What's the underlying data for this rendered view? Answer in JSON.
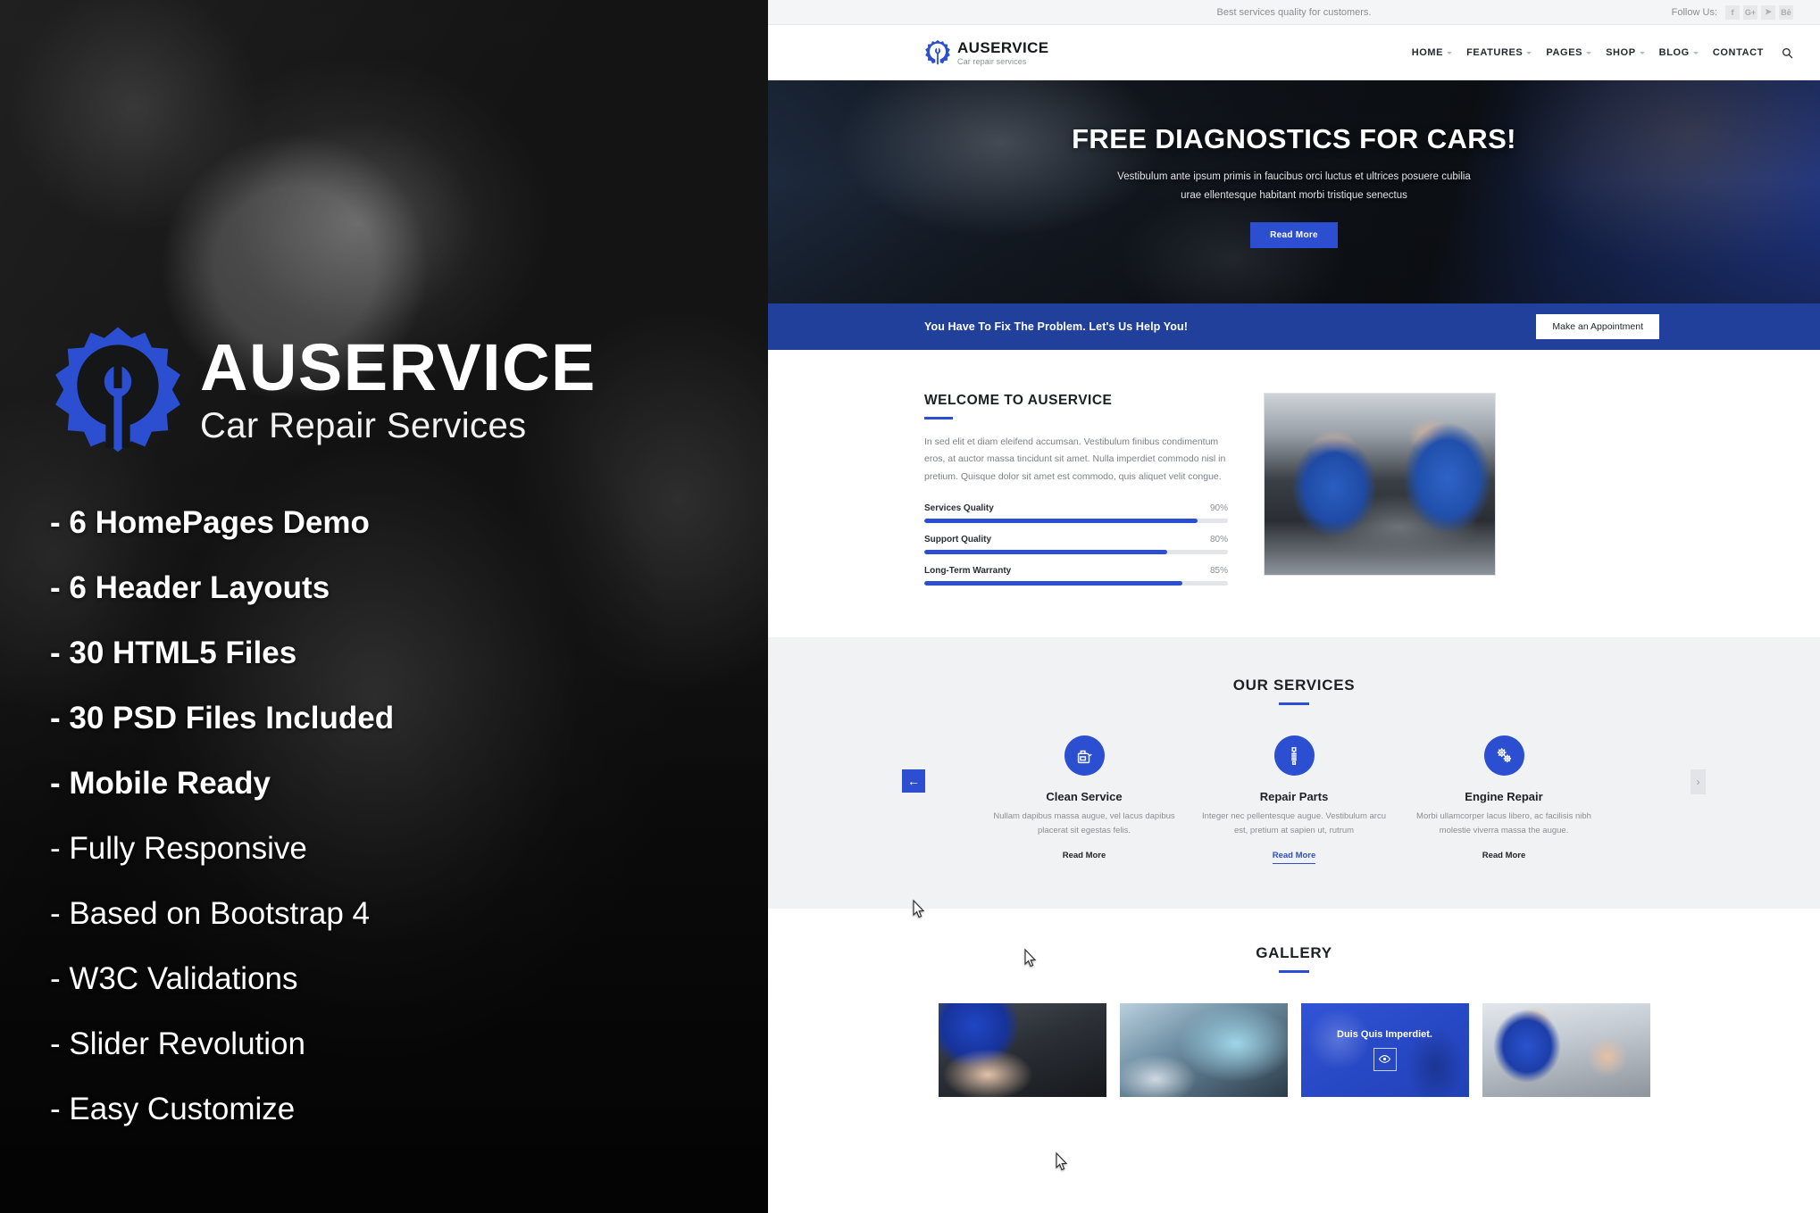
{
  "promo": {
    "brand_name": "AUSERVICE",
    "brand_tagline": "Car Repair Services",
    "logo_icon": "gear-wrench-logo-icon",
    "features": [
      {
        "label": "- 6 HomePages Demo",
        "emphasis": "bold"
      },
      {
        "label": "- 6 Header Layouts",
        "emphasis": "bold"
      },
      {
        "label": "- 30 HTML5 Files",
        "emphasis": "bold"
      },
      {
        "label": "- 30 PSD Files Included",
        "emphasis": "bold"
      },
      {
        "label": "- Mobile Ready",
        "emphasis": "bold"
      },
      {
        "label": "- Fully Responsive",
        "emphasis": "light"
      },
      {
        "label": "- Based on Bootstrap 4",
        "emphasis": "light"
      },
      {
        "label": "- W3C Validations",
        "emphasis": "light"
      },
      {
        "label": "- Slider Revolution",
        "emphasis": "light"
      },
      {
        "label": "- Easy Customize",
        "emphasis": "light"
      }
    ]
  },
  "site": {
    "topbar": {
      "tagline": "Best services quality for customers.",
      "follow_label": "Follow Us:",
      "social": [
        {
          "name": "facebook-icon",
          "glyph": "f"
        },
        {
          "name": "google-plus-icon",
          "glyph": "G+"
        },
        {
          "name": "twitter-icon",
          "glyph": "➤"
        },
        {
          "name": "behance-icon",
          "glyph": "Bē"
        }
      ]
    },
    "header": {
      "brand_name": "AUSERVICE",
      "brand_sub": "Car repair services",
      "logo_icon": "gear-wrench-logo-icon",
      "nav": [
        {
          "label": "HOME",
          "has_dropdown": true
        },
        {
          "label": "FEATURES",
          "has_dropdown": true
        },
        {
          "label": "PAGES",
          "has_dropdown": true
        },
        {
          "label": "SHOP",
          "has_dropdown": true
        },
        {
          "label": "BLOG",
          "has_dropdown": true
        },
        {
          "label": "CONTACT",
          "has_dropdown": false
        }
      ],
      "search_icon": "search-icon"
    },
    "hero": {
      "title": "FREE DIAGNOSTICS FOR CARS!",
      "desc_line1": "Vestibulum ante ipsum primis in faucibus orci luctus et ultrices posuere cubilia",
      "desc_line2": "urae ellentesque habitant morbi tristique senectus",
      "button": "Read More"
    },
    "cta": {
      "text": "You Have To Fix The Problem. Let's Us Help You!",
      "button": "Make an Appointment"
    },
    "welcome": {
      "title": "WELCOME TO AUSERVICE",
      "paragraph": "In sed elit et diam eleifend accumsan. Vestibulum finibus condimentum eros, at auctor massa tincidunt sit amet. Nulla imperdiet commodo nisl in pretium. Quisque dolor sit amet est commodo, quis aliquet velit congue.",
      "bars": [
        {
          "label": "Services Quality",
          "pct_text": "90%",
          "pct": 90
        },
        {
          "label": "Support Quality",
          "pct_text": "80%",
          "pct": 80
        },
        {
          "label": "Long-Term Warranty",
          "pct_text": "85%",
          "pct": 85
        }
      ]
    },
    "services": {
      "title": "OUR SERVICES",
      "prev_label": "←",
      "next_label": "›",
      "items": [
        {
          "name": "Clean Service",
          "icon": "oil-canister-icon",
          "desc": "Nullam dapibus massa augue, vel lacus dapibus placerat sit egestas felis.",
          "read_more": "Read More",
          "active": false
        },
        {
          "name": "Repair Parts",
          "icon": "spring-shock-absorber-icon",
          "desc": "Integer nec pellentesque augue. Vestibulum arcu est, pretium at sapien ut, rutrum",
          "read_more": "Read More",
          "active": true
        },
        {
          "name": "Engine Repair",
          "icon": "gears-icon",
          "desc": "Morbi ullamcorper lacus libero, ac facilisis nibh molestie viverra massa the augue.",
          "read_more": "Read More",
          "active": false
        }
      ]
    },
    "gallery": {
      "title": "GALLERY",
      "tiles": [
        {
          "name": "gallery-tile-wrench",
          "overlay": false
        },
        {
          "name": "gallery-tile-dashboard",
          "overlay": false
        },
        {
          "name": "gallery-tile-overlay",
          "overlay": true,
          "caption": "Duis Quis Imperdiet.",
          "icon": "eye-icon"
        },
        {
          "name": "gallery-tile-customer",
          "overlay": false
        }
      ]
    }
  },
  "colors": {
    "brand_blue": "#2b4fd0",
    "cta_blue": "#20409b",
    "section_gray": "#f1f2f4",
    "topbar_gray": "#f4f5f7"
  }
}
